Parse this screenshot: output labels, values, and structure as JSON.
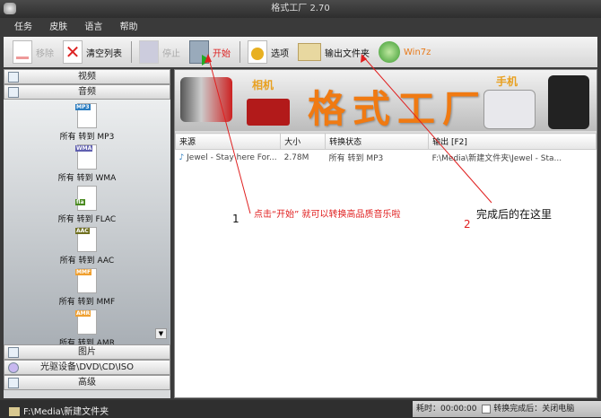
{
  "window": {
    "title": "格式工厂 2.70"
  },
  "menu": [
    "任务",
    "皮肤",
    "语言",
    "帮助"
  ],
  "toolbar": {
    "remove": "移除",
    "clear": "清空列表",
    "stop": "停止",
    "start": "开始",
    "options": "选项",
    "output_folder": "输出文件夹",
    "win7z": "Win7z"
  },
  "sidebar": {
    "categories_top": [
      "视频",
      "音频"
    ],
    "items": [
      {
        "badge": "MP3",
        "label": "所有 转到 MP3",
        "color": "#2a7cc0"
      },
      {
        "badge": "WMA",
        "label": "所有 转到 WMA",
        "color": "#6060b0"
      },
      {
        "badge": "fla",
        "label": "所有 转到 FLAC",
        "color": "#4a8a20"
      },
      {
        "badge": "AAC",
        "label": "所有 转到 AAC",
        "color": "#707020"
      },
      {
        "badge": "MMF",
        "label": "所有 转到 MMF",
        "color": "#f0a030"
      },
      {
        "badge": "AMR",
        "label": "所有 转到 AMR",
        "color": "#f0a030"
      }
    ],
    "categories_bottom": [
      "图片",
      "光驱设备\\DVD\\CD\\ISO",
      "高级"
    ]
  },
  "banner": {
    "title": "格式工厂",
    "camera": "相机",
    "phone": "手机"
  },
  "table": {
    "headers": [
      "来源",
      "大小",
      "转换状态",
      "输出 [F2]"
    ],
    "rows": [
      [
        "Jewel - Stay here For...",
        "2.78M",
        "所有 转到 MP3",
        "F:\\Media\\新建文件夹\\Jewel - Sta..."
      ]
    ]
  },
  "annotations": {
    "n1": "1",
    "text1": "点击“开始” 就可以转换高品质音乐啦",
    "n2": "2",
    "text2": "完成后的在这里"
  },
  "statusbar": {
    "path": "F:\\Media\\新建文件夹",
    "elapsed": "耗时：00:00:00",
    "shutdown": "转换完成后：关闭电脑"
  }
}
